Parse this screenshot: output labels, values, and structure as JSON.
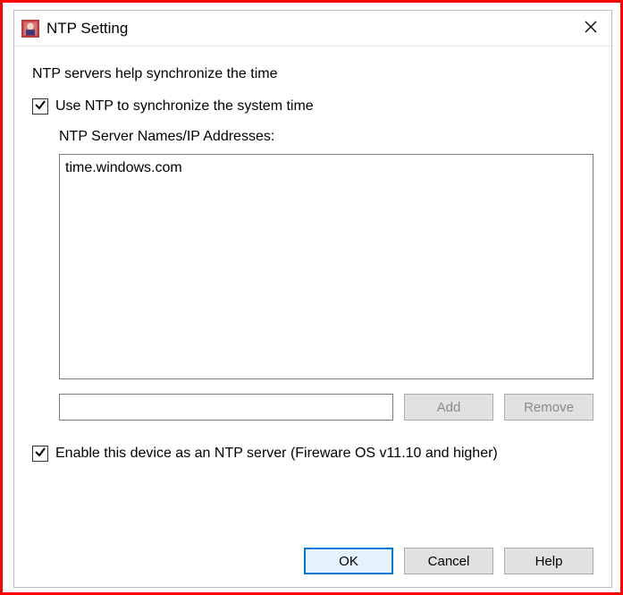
{
  "window": {
    "title": "NTP Setting"
  },
  "intro": "NTP servers help synchronize the time",
  "useNtp": {
    "label": "Use NTP to synchronize the system time",
    "checked": true
  },
  "serverList": {
    "label": "NTP Server Names/IP Addresses:",
    "items": [
      "time.windows.com"
    ]
  },
  "newServerInput": "",
  "buttons": {
    "add": "Add",
    "remove": "Remove",
    "ok": "OK",
    "cancel": "Cancel",
    "help": "Help"
  },
  "enableServer": {
    "label": "Enable this device as an NTP server (Fireware OS v11.10 and higher)",
    "checked": true
  }
}
